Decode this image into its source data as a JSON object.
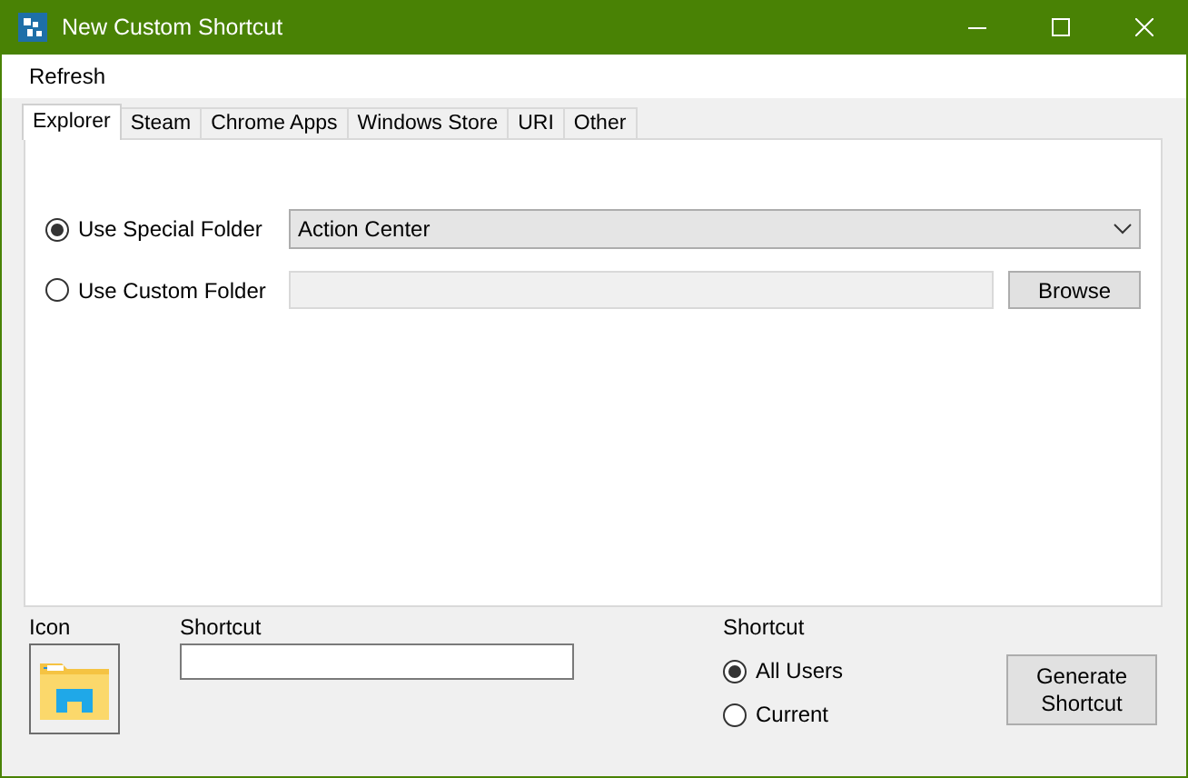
{
  "window": {
    "title": "New Custom Shortcut"
  },
  "menu": [
    "Refresh"
  ],
  "tabs": [
    {
      "label": "Explorer",
      "selected": true
    },
    {
      "label": "Steam",
      "selected": false
    },
    {
      "label": "Chrome Apps",
      "selected": false
    },
    {
      "label": "Windows Store",
      "selected": false
    },
    {
      "label": "URI",
      "selected": false
    },
    {
      "label": "Other",
      "selected": false
    }
  ],
  "folder_options": [
    {
      "label": "Use Special Folder",
      "selected": true,
      "kind": "dropdown",
      "value": "Action Center"
    },
    {
      "label": "Use Custom Folder",
      "selected": false,
      "kind": "path",
      "disabled": true,
      "button": "Browse"
    }
  ],
  "icon_label": "Icon",
  "shortcut_name": {
    "label": "Shortcut"
  },
  "shortcut_scope": {
    "label": "Shortcut",
    "options": [
      {
        "label": "All Users",
        "selected": true
      },
      {
        "label": "Current",
        "selected": false
      }
    ]
  },
  "generate_button": "Generate Shortcut"
}
